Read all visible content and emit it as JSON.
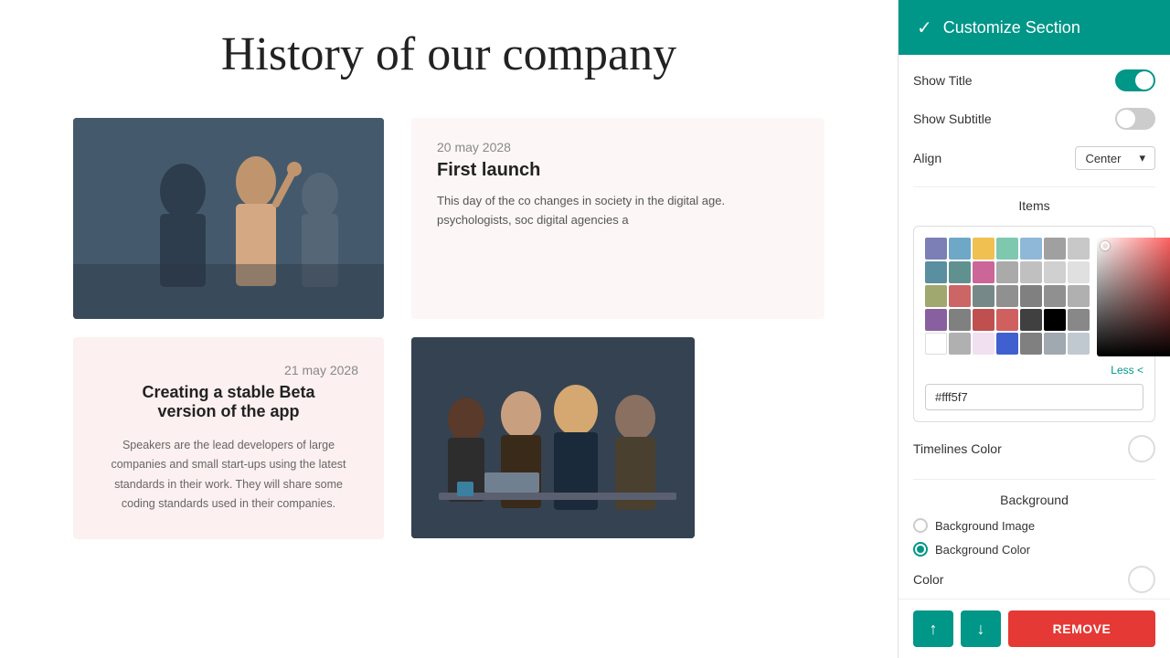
{
  "page": {
    "title": "History of our company"
  },
  "timeline": {
    "items": [
      {
        "date": "20 may 2028",
        "title": "First launch",
        "text": "This day of the co changes in society in the digital age. psychologists, soc digital agencies a"
      },
      {
        "date": "21 may 2028",
        "title": "Creating a stable Beta version of the app",
        "text": "Speakers are the lead developers of large companies and small start-ups using the latest standards in their work. They will share some coding standards used in their companies."
      }
    ]
  },
  "panel": {
    "header_title": "Customize Section",
    "check_icon": "✓",
    "show_title_label": "Show Title",
    "show_subtitle_label": "Show Subtitle",
    "align_label": "Align",
    "align_value": "Center",
    "items_label": "Items",
    "timelines_color_label": "Timelines Color",
    "background_label": "Background",
    "bg_image_label": "Background Image",
    "bg_color_label": "Background Color",
    "color_label": "Color",
    "remove_btn": "REMOVE",
    "up_arrow": "↑",
    "down_arrow": "↓"
  },
  "color_picker": {
    "hex_value": "#fff5f7",
    "less_label": "Less <",
    "swatches": [
      "#7b7fb5",
      "#6fa8c7",
      "#f0c050",
      "#7ec8b0",
      "#8fb8d8",
      "#a0a0a0",
      "#5a8fa0",
      "#609090",
      "#cc6699",
      "#aaaaaa",
      "#c0c0c0",
      "#d0d0d0",
      "#a0a870",
      "#cc6666",
      "#778888",
      "#909090",
      "#808080",
      "#909090",
      "#8860a0",
      "#808080",
      "#c05050",
      "#d06060",
      "#404040",
      "#888888",
      "#ffffff",
      "#b0b0b0",
      "#f0e0f0",
      "#4060d0",
      "#808080",
      "#a0a8b0",
      "#c0c8d0"
    ]
  }
}
